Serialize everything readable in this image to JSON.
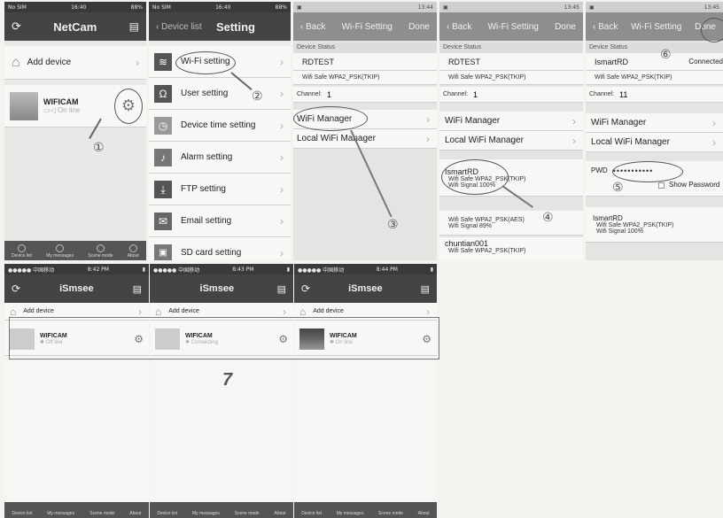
{
  "p1": {
    "status_left": "No SIM",
    "status_time": "16:40",
    "status_right": "88%",
    "title": "NetCam",
    "add_device": "Add device",
    "device_name": "WIFICAM",
    "device_status": "On line",
    "tab": [
      "Device list",
      "My messages",
      "Scene mode",
      "About"
    ],
    "marker": "①"
  },
  "p2": {
    "status_left": "No SIM",
    "status_time": "16:40",
    "status_right": "88%",
    "back": "Device list",
    "title": "Setting",
    "items": [
      "Wi-Fi setting",
      "User setting",
      "Device time setting",
      "Alarm setting",
      "FTP setting",
      "Email setting",
      "SD card setting"
    ],
    "marker": "②"
  },
  "p3": {
    "status_time": "13:44",
    "back": "Back",
    "title": "Wi-Fi Setting",
    "done": "Done",
    "section": "Device Status",
    "ssid": "RDTEST",
    "safe_label": "Wifi Safe",
    "safe": "WPA2_PSK(TKIP)",
    "channel_label": "Channel:",
    "channel": "1",
    "wifi_manager": "WiFi Manager",
    "local": "Local WiFi Manager",
    "marker": "③"
  },
  "p4": {
    "status_time": "13:45",
    "back": "Back",
    "title": "Wi-Fi Setting",
    "done": "Done",
    "section": "Device Status",
    "ssid": "RDTEST",
    "safe_label": "Wifi Safe",
    "safe": "WPA2_PSK(TKIP)",
    "channel_label": "Channel:",
    "channel": "1",
    "wifi_manager": "WiFi Manager",
    "local": "Local WiFi Manager",
    "net1": {
      "name": "IsmartRD",
      "safe": "Wifi Safe  WPA2_PSK(TKIP)",
      "signal": "Wifi Signal  100%"
    },
    "net2": {
      "safe": "Wifi Safe  WPA2_PSK(AES)",
      "signal": "Wifi Signal  89%"
    },
    "net3": {
      "name": "chuntian001",
      "safe": "Wifi Safe  WPA2_PSK(TKIP)"
    },
    "marker": "④"
  },
  "p5": {
    "status_time": "13:45",
    "back": "Back",
    "title": "Wi-Fi Setting",
    "done": "Done",
    "section": "Device Status",
    "ssid": "IsmartRD",
    "connected": "Connected",
    "safe": "Wifi Safe  WPA2_PSK(TKIP)",
    "channel_label": "Channel:",
    "channel": "11",
    "wifi_manager": "WiFi Manager",
    "local": "Local WiFi Manager",
    "pwd_label": "PWD",
    "pwd": "•••••••••••",
    "show_password": "Show Password",
    "net": {
      "name": "IsmartRD",
      "safe": "Wifi Safe  WPA2_PSK(TKIP)",
      "signal": "Wifi Signal  100%"
    },
    "marker5": "⑤",
    "marker6": "⑥"
  },
  "bottom": [
    {
      "status_time": "8:42 PM",
      "title": "iSmsee",
      "add_device": "Add device",
      "device_name": "WIFICAM",
      "device_status": "Off line"
    },
    {
      "status_time": "8:43 PM",
      "title": "iSmsee",
      "add_device": "Add device",
      "device_name": "WIFICAM",
      "device_status": "Connecting"
    },
    {
      "status_time": "8:44 PM",
      "title": "iSmsee",
      "add_device": "Add device",
      "device_name": "WIFICAM",
      "device_status": "On line"
    }
  ],
  "bottom_tabs": [
    "Device list",
    "My messages",
    "Scene mode",
    "About"
  ],
  "step7": "7"
}
